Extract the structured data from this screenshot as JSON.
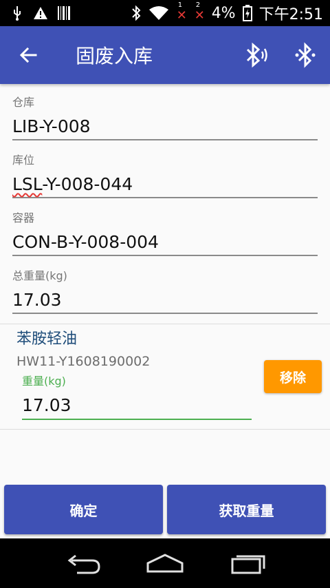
{
  "status_bar": {
    "battery_percent": "4%",
    "time": "下午2:51",
    "sim1": "1",
    "sim2": "2"
  },
  "app_bar": {
    "title": "固废入库"
  },
  "form": {
    "warehouse_label": "仓库",
    "warehouse_value": "LIB-Y-008",
    "location_label": "库位",
    "location_prefix": "LSL",
    "location_suffix": "-Y-008-044",
    "container_label": "容器",
    "container_value": "CON-B-Y-008-004",
    "total_weight_label": "总重量(kg)",
    "total_weight_value": "17.03"
  },
  "item": {
    "name": "苯胺轻油",
    "code": "HW11-Y1608190002",
    "weight_label": "重量(kg)",
    "weight_value": "17.03",
    "remove_label": "移除"
  },
  "actions": {
    "confirm_label": "确定",
    "get_weight_label": "获取重量"
  },
  "colors": {
    "primary": "#3f51b5",
    "accent": "#ff9800",
    "focus": "#4caf50"
  }
}
